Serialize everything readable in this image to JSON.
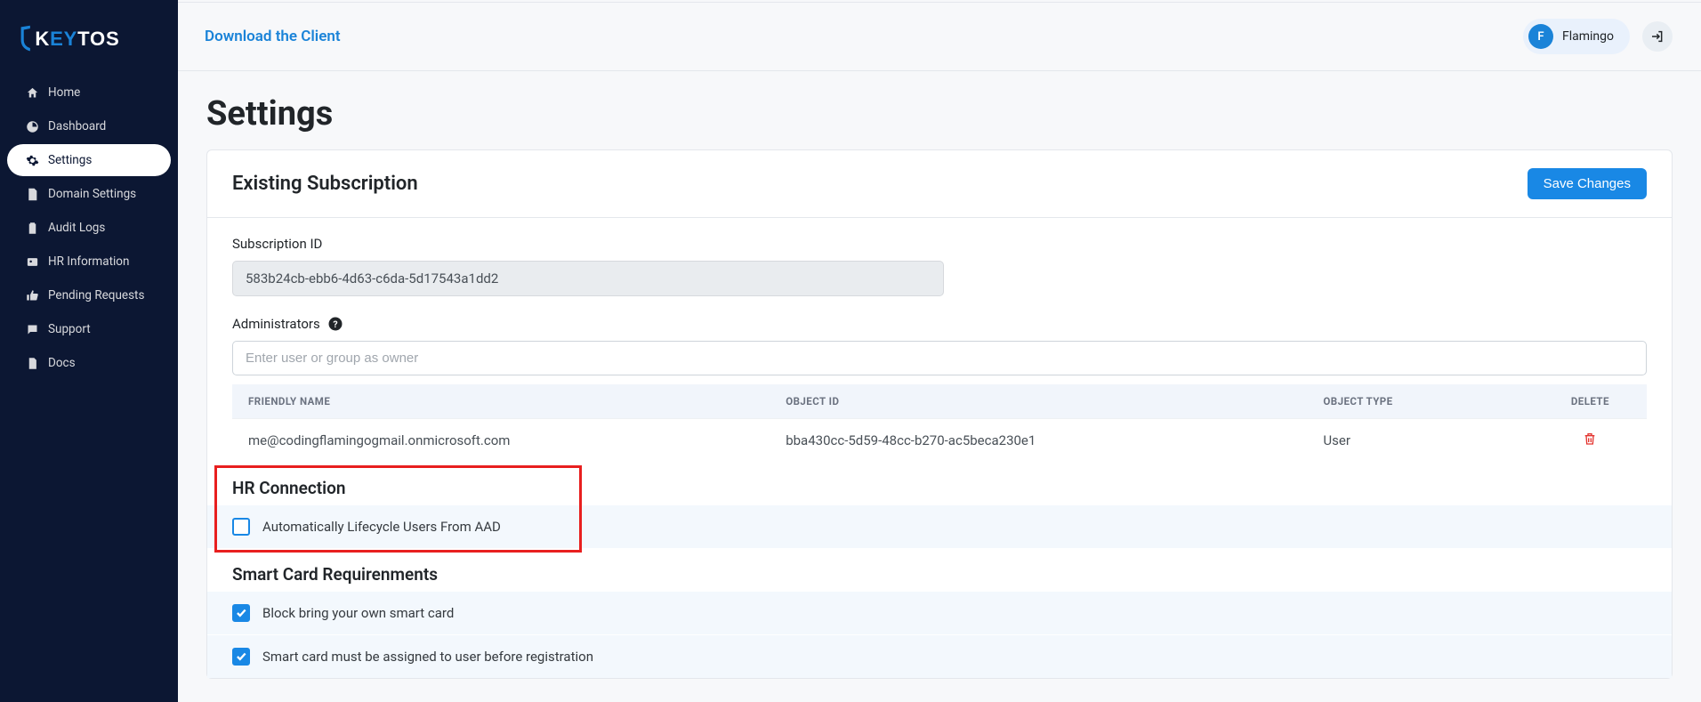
{
  "brand": {
    "name": "KEYTOS"
  },
  "sidebar": {
    "items": [
      {
        "label": "Home"
      },
      {
        "label": "Dashboard"
      },
      {
        "label": "Settings"
      },
      {
        "label": "Domain Settings"
      },
      {
        "label": "Audit Logs"
      },
      {
        "label": "HR Information"
      },
      {
        "label": "Pending Requests"
      },
      {
        "label": "Support"
      },
      {
        "label": "Docs"
      }
    ]
  },
  "topbar": {
    "download_link": "Download the Client",
    "user_name": "Flamingo",
    "user_initial": "F"
  },
  "page": {
    "title": "Settings",
    "card_title": "Existing Subscription",
    "save_button": "Save Changes"
  },
  "subscription": {
    "label": "Subscription ID",
    "value": "583b24cb-ebb6-4d63-c6da-5d17543a1dd2"
  },
  "admins": {
    "label": "Administrators",
    "placeholder": "Enter user or group as owner",
    "cols": {
      "friendly_name": "FRIENDLY NAME",
      "object_id": "OBJECT ID",
      "object_type": "OBJECT TYPE",
      "delete": "DELETE"
    },
    "rows": [
      {
        "friendly_name": "me@codingflamingogmail.onmicrosoft.com",
        "object_id": "bba430cc-5d59-48cc-b270-ac5beca230e1",
        "object_type": "User"
      }
    ]
  },
  "hr": {
    "title": "HR Connection",
    "option1": "Automatically Lifecycle Users From AAD"
  },
  "smartcard": {
    "title": "Smart Card Requirenments",
    "option1": "Block bring your own smart card",
    "option2": "Smart card must be assigned to user before registration"
  }
}
